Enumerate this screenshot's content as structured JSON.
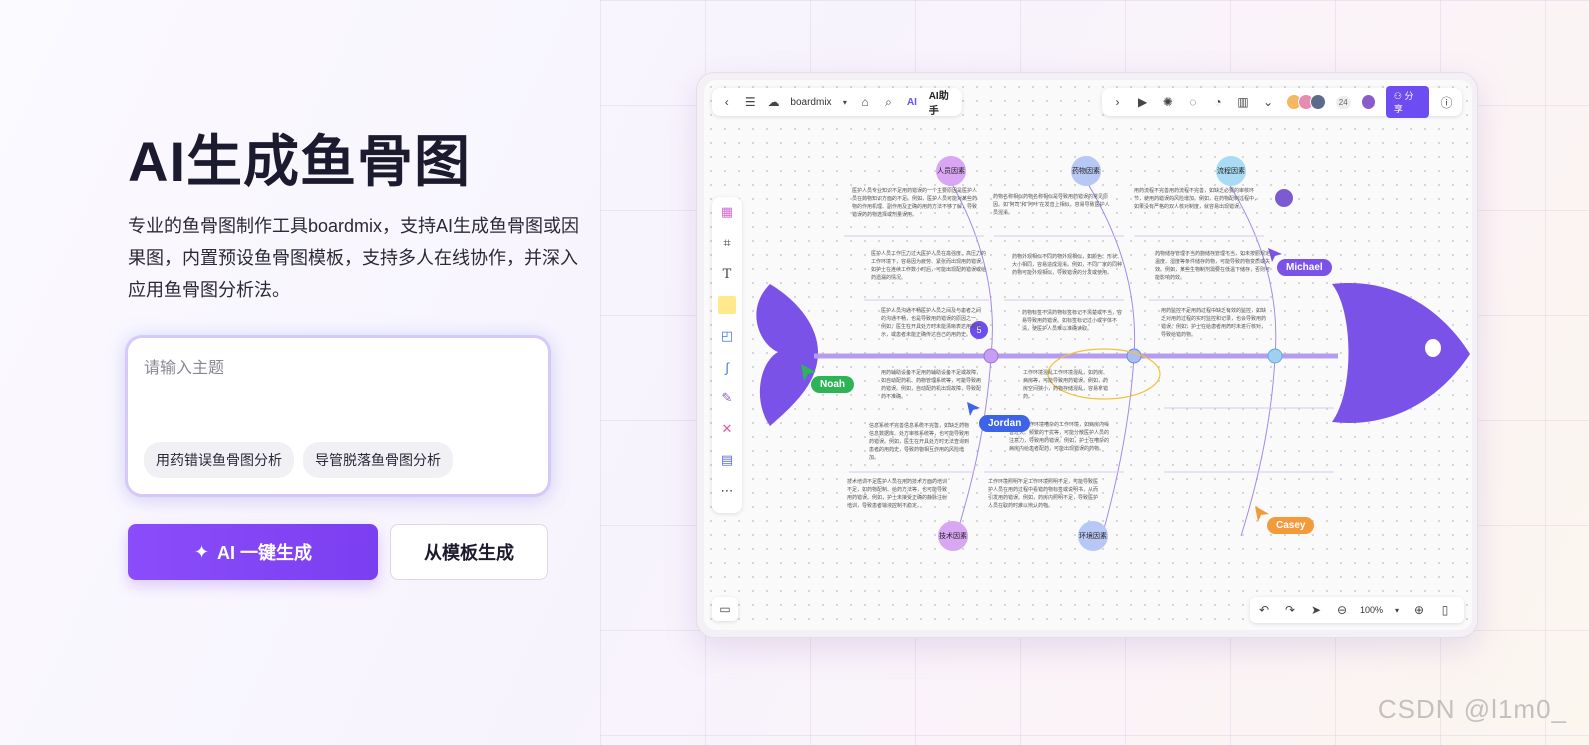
{
  "hero": {
    "title": "AI生成鱼骨图",
    "description": "专业的鱼骨图制作工具boardmix，支持AI生成鱼骨图或因果图，内置预设鱼骨图模板，支持多人在线协作，并深入应用鱼骨图分析法。"
  },
  "input": {
    "placeholder": "请输入主题",
    "chips": [
      "用药错误鱼骨图分析",
      "导管脱落鱼骨图分析"
    ]
  },
  "buttons": {
    "primary": "AI 一键生成",
    "secondary": "从模板生成"
  },
  "board": {
    "toolbar_left": {
      "brand": "boardmix",
      "ai": "AI助手"
    },
    "toolbar_right": {
      "collaborator_count": "24",
      "share": "分享"
    },
    "zoom": "100%",
    "categories_top": [
      "人员因素",
      "药物因素",
      "流程因素"
    ],
    "categories_bottom": [
      "技术因素",
      "环境因素"
    ],
    "badge": "5",
    "cursors": [
      "Noah",
      "Jordan",
      "Michael",
      "Casey"
    ],
    "notes": [
      "医护人员专业知识不足用药错误的一个主要原因是医护人员在药物知识方面的不足。例如，医护人员可能对某些药物的作用机理、副作用及正确的用药方法不够了解，导致错误的药物选择或剂量误用。",
      "医护人员工作压力过大医护人员在高强度、高压力的工作环境下，容易因为疲劳、紧张而出现用药错误。如护士在连续工作数小时后，可能出现配药错误或给药遗漏的情况。",
      "医护人员沟通不畅医护人员之间及与患者之间的沟通不畅，也是导致用药错误的原因之一。例如，医生在开具处方时未能清晰表达用药指示，或患者未能正确传达自己的用药史。",
      "药物名称相似药物名称相似是导致用药错误的常见原因。如“阿司”和“阿咔”在发音上相似，容易导致医护人员混淆。",
      "药物外观相似不同药物外观相似，如颜色、形状、大小相同，容易造成混淆。例如，不同厂家的同种药物可能外观相似，导致错误的分发或使用。",
      "药物标签不清药物标签标记不清楚或不当，容易导致用药错误。如标签标记过小或字体不清，使医护人员难以准确读取。",
      "用药流程不完善用药流程不完善，如缺乏必要的审核环节，使用药错误的风险增加。例如，在药物配制过程中，如果没有严格的双人核对制度，就容易出现错误。",
      "药物储存管理不当药物储存管理不当，如未按照规定温度、湿度等条件储存药物，可能导致药物变质或失效。例如，某些生物制剂需要在低温下储存，否则可能影响药效。",
      "用药监控不足用药过程中缺乏有效的监控，如缺乏对用药过程的实时监控和记录，也会导致用药错误。例如，护士在给患者用药时未进行核对，导致给错药物。",
      "用药辅助设备不足用药辅助设备不足或故障，如自动配药机、药物管理系统等，可能导致用药错误。例如，自动配药机出现故障，导致配药不准确。",
      "信息系统不完善信息系统不完善，如缺乏药物信息数据库、处方审核系统等，也可能导致用药错误。例如，医生在开具处方时无法查询到患者的用药史，导致药物相互作用的风险增加。",
      "技术培训不足医护人员在用药技术方面的培训不足，如药物配制、给药方法等，也可能导致用药错误。例如，护士未接受正确的静脉注射培训，导致患者输液控制不稳定。",
      "工作环境混乱工作环境混乱，如药房、病房等，可能导致用药错误。例如，药房空间狭小，药物存储混乱，容易拿错药。",
      "嘈杂的工作环境嘈杂的工作环境，如病房内噪音过大、频繁的干扰等，可能分散医护人员的注意力，导致用药错误。例如，护士在嘈杂的病房内给患者配药，可能出现错误的药物。",
      "工作环境照明不足工作环境照明不足，可能导致医护人员在用药过程中看错药物标签或说明书，从而引发用药错误。例如，药房内照明不足，导致医护人员在取药时难以辨认药物。"
    ]
  },
  "watermark": "CSDN @l1m0_"
}
